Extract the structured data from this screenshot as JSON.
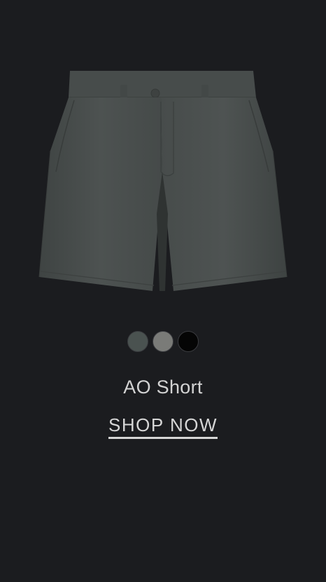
{
  "product": {
    "name": "AO Short",
    "image_icon": "shorts-product-image",
    "swatches": [
      {
        "name": "slate-green",
        "color": "#4a5250",
        "selected": true
      },
      {
        "name": "gray",
        "color": "#7a7b78",
        "selected": false
      },
      {
        "name": "black",
        "color": "#050505",
        "selected": false
      }
    ]
  },
  "cta": {
    "label": "SHOP NOW"
  },
  "colors": {
    "background": "#1b1c1f",
    "text": "#d6d6d6",
    "shorts": "#4a4f4e"
  }
}
